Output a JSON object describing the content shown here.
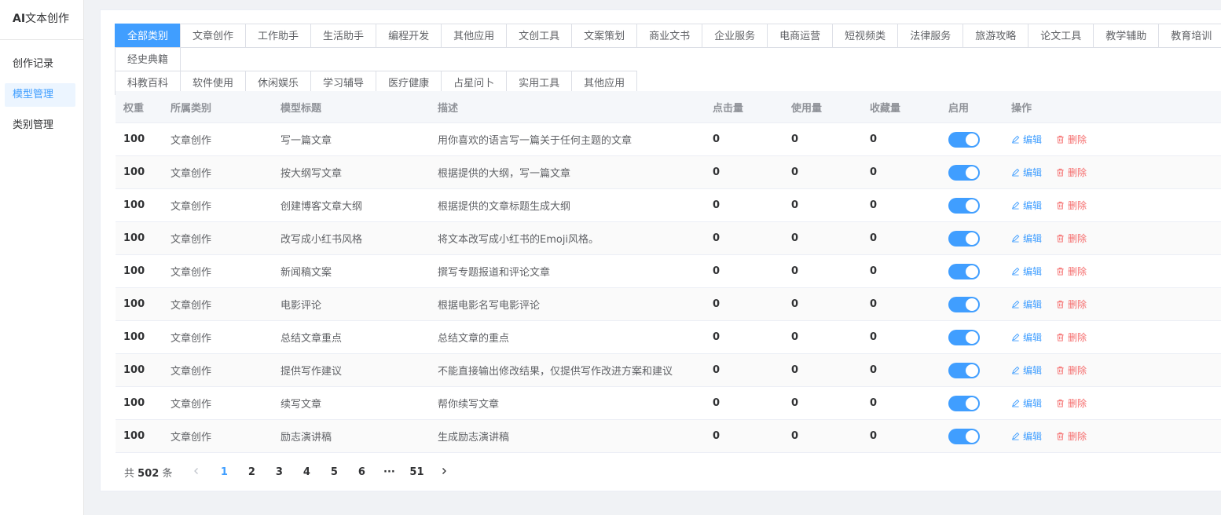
{
  "sidebar": {
    "brand_prefix": "AI",
    "brand_suffix": "文本创作",
    "items": [
      {
        "label": "创作记录"
      },
      {
        "label": "模型管理"
      },
      {
        "label": "类别管理"
      }
    ]
  },
  "categories": {
    "row1": [
      "全部类别",
      "文章创作",
      "工作助手",
      "生活助手",
      "编程开发",
      "其他应用",
      "文创工具",
      "文案策划",
      "商业文书",
      "企业服务",
      "电商运营",
      "短视频类",
      "法律服务",
      "旅游攻略",
      "论文工具",
      "教学辅助",
      "教育培训",
      "经史典籍"
    ],
    "row2": [
      "科教百科",
      "软件使用",
      "休闲娱乐",
      "学习辅导",
      "医疗健康",
      "占星问卜",
      "实用工具",
      "其他应用"
    ]
  },
  "table": {
    "headers": {
      "weight": "权重",
      "category": "所属类别",
      "title": "模型标题",
      "desc": "描述",
      "clicks": "点击量",
      "uses": "使用量",
      "favorites": "收藏量",
      "enabled": "启用",
      "actions": "操作"
    },
    "edit_label": "编辑",
    "delete_label": "删除",
    "rows": [
      {
        "weight": "100",
        "category": "文章创作",
        "title": "写一篇文章",
        "desc": "用你喜欢的语言写一篇关于任何主题的文章",
        "clicks": "0",
        "uses": "0",
        "favorites": "0",
        "enabled": true
      },
      {
        "weight": "100",
        "category": "文章创作",
        "title": "按大纲写文章",
        "desc": "根据提供的大纲，写一篇文章",
        "clicks": "0",
        "uses": "0",
        "favorites": "0",
        "enabled": true
      },
      {
        "weight": "100",
        "category": "文章创作",
        "title": "创建博客文章大纲",
        "desc": "根据提供的文章标题生成大纲",
        "clicks": "0",
        "uses": "0",
        "favorites": "0",
        "enabled": true
      },
      {
        "weight": "100",
        "category": "文章创作",
        "title": "改写成小红书风格",
        "desc": "将文本改写成小红书的Emoji风格。",
        "clicks": "0",
        "uses": "0",
        "favorites": "0",
        "enabled": true
      },
      {
        "weight": "100",
        "category": "文章创作",
        "title": "新闻稿文案",
        "desc": "撰写专题报道和评论文章",
        "clicks": "0",
        "uses": "0",
        "favorites": "0",
        "enabled": true
      },
      {
        "weight": "100",
        "category": "文章创作",
        "title": "电影评论",
        "desc": "根据电影名写电影评论",
        "clicks": "0",
        "uses": "0",
        "favorites": "0",
        "enabled": true
      },
      {
        "weight": "100",
        "category": "文章创作",
        "title": "总结文章重点",
        "desc": "总结文章的重点",
        "clicks": "0",
        "uses": "0",
        "favorites": "0",
        "enabled": true
      },
      {
        "weight": "100",
        "category": "文章创作",
        "title": "提供写作建议",
        "desc": "不能直接输出修改结果，仅提供写作改进方案和建议",
        "clicks": "0",
        "uses": "0",
        "favorites": "0",
        "enabled": true
      },
      {
        "weight": "100",
        "category": "文章创作",
        "title": "续写文章",
        "desc": "帮你续写文章",
        "clicks": "0",
        "uses": "0",
        "favorites": "0",
        "enabled": true
      },
      {
        "weight": "100",
        "category": "文章创作",
        "title": "励志演讲稿",
        "desc": "生成励志演讲稿",
        "clicks": "0",
        "uses": "0",
        "favorites": "0",
        "enabled": true
      }
    ]
  },
  "pagination": {
    "total_prefix": "共",
    "total": "502",
    "total_suffix": "条",
    "pages": [
      "1",
      "2",
      "3",
      "4",
      "5",
      "6",
      "···",
      "51"
    ],
    "current": "1"
  },
  "colors": {
    "primary": "#409eff",
    "danger": "#f56c6c"
  }
}
